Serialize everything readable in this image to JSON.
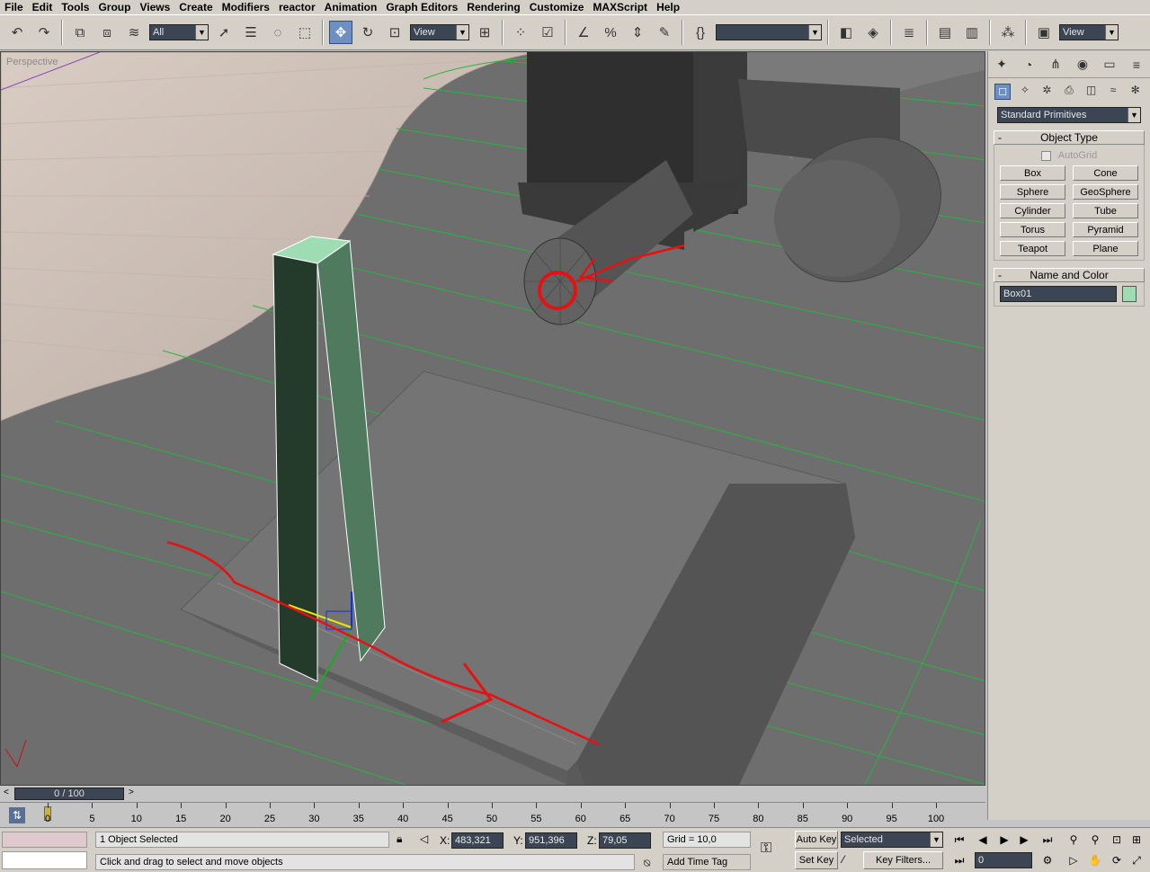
{
  "menu": [
    "File",
    "Edit",
    "Tools",
    "Group",
    "Views",
    "Create",
    "Modifiers",
    "reactor",
    "Animation",
    "Graph Editors",
    "Rendering",
    "Customize",
    "MAXScript",
    "Help"
  ],
  "toolbar": {
    "selection_filter": "All",
    "ref_coord": "View",
    "named_selection": "",
    "view_dd": "View"
  },
  "viewport": {
    "label": "Perspective"
  },
  "command_panel": {
    "category": "Standard Primitives",
    "object_type_title": "Object Type",
    "autogrid": "AutoGrid",
    "buttons": [
      "Box",
      "Cone",
      "Sphere",
      "GeoSphere",
      "Cylinder",
      "Tube",
      "Torus",
      "Pyramid",
      "Teapot",
      "Plane"
    ],
    "name_color_title": "Name and Color",
    "object_name": "Box01",
    "object_color": "#9edcb4"
  },
  "time_slider": {
    "position": "0 / 100"
  },
  "track_bar": {
    "ticks": [
      "0",
      "5",
      "10",
      "15",
      "20",
      "25",
      "30",
      "35",
      "40",
      "45",
      "50",
      "55",
      "60",
      "65",
      "70",
      "75",
      "80",
      "85",
      "90",
      "95",
      "100"
    ]
  },
  "status": {
    "selection": "1 Object Selected",
    "prompt": "Click and drag to select and move objects",
    "x_label": "X:",
    "x": "483,321",
    "y_label": "Y:",
    "y": "951,396",
    "z_label": "Z:",
    "z": "79,05",
    "grid": "Grid = 10,0",
    "add_time_tag": "Add Time Tag",
    "auto_key": "Auto Key",
    "set_key": "Set Key",
    "key_mode": "Selected",
    "key_filters": "Key Filters...",
    "frame": "0"
  },
  "colors": {
    "annotation_red": "#e81010",
    "grid_green": "#27b53f",
    "selection_blue": "#6d8fc1"
  }
}
